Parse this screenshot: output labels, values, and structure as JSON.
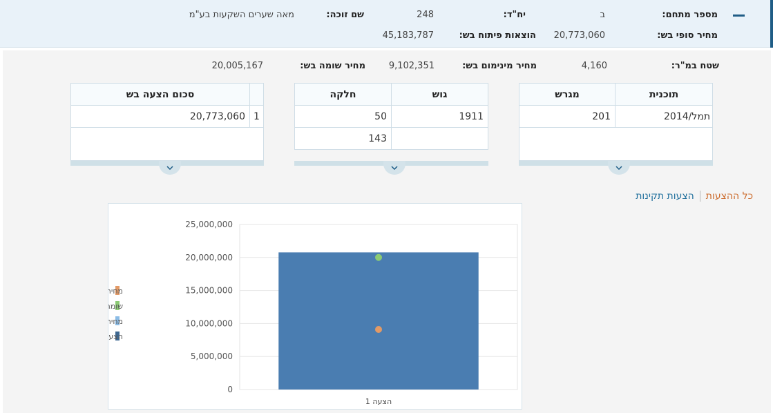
{
  "header": {
    "bidder_number_label": "מספר מתחם:",
    "bidder_number_value": "ב",
    "units_label": "יח\"ד:",
    "units_value": "248",
    "winner_label": "שם זוכה:",
    "winner_value": "מאה שערים השקעות בע\"מ",
    "final_price_label": "מחיר סופי בש:",
    "final_price_value": "20,773,060",
    "development_label": "הוצאות פיתוח בש:",
    "development_value": "45,183,787"
  },
  "summary": {
    "area_label": "שטח במ\"ר:",
    "area_value": "4,160",
    "min_price_label": "מחיר מינימום בש:",
    "min_price_value": "9,102,351",
    "appraiser_label": "מחיר שומה בש:",
    "appraiser_value": "20,005,167"
  },
  "plan_table": {
    "headers": [
      "תוכנית",
      "מגרש"
    ],
    "rows": [
      [
        "תמל/2014",
        "201"
      ]
    ]
  },
  "parcel_table": {
    "headers": [
      "גוש",
      "חלקה"
    ],
    "rows": [
      [
        "1911",
        "50"
      ],
      [
        "",
        "143"
      ]
    ]
  },
  "offer_table": {
    "headers": [
      "",
      "סכום הצעה בש"
    ],
    "rows": [
      [
        "1",
        "20,773,060"
      ]
    ]
  },
  "tabs": {
    "all": "כל ההצעות",
    "valid": "הצעות תקינות"
  },
  "colors": {
    "bar": "#4a7db1",
    "min_price": "#e39a66",
    "appraiser": "#8ccb74",
    "avg_offer": "#8bbce6",
    "offers": "#3e6891"
  },
  "chart_data": {
    "type": "bar",
    "categories": [
      "הצעה 1"
    ],
    "series": [
      {
        "name": "הצעות קרקע",
        "type": "bar",
        "values": [
          20773060
        ]
      },
      {
        "name": "שומת קרקע",
        "type": "point",
        "values": [
          20005167
        ]
      },
      {
        "name": "מחיר מינימום",
        "type": "point",
        "values": [
          9102351
        ]
      },
      {
        "name": "מחיר ממוצע קרקע",
        "type": "legend-only",
        "values": []
      }
    ],
    "ylim": [
      0,
      25000000
    ],
    "yticks": [
      "0",
      "5,000,000",
      "10,000,000",
      "15,000,000",
      "20,000,000",
      "25,000,000"
    ],
    "yticks_values": [
      0,
      5000000,
      10000000,
      15000000,
      20000000,
      25000000
    ],
    "legend": [
      "מחיר מינימום",
      "שומת קרקע",
      "מחיר ממוצע קרקע",
      "הצעות קרקע"
    ],
    "legend_placement": "left",
    "grid": true
  }
}
